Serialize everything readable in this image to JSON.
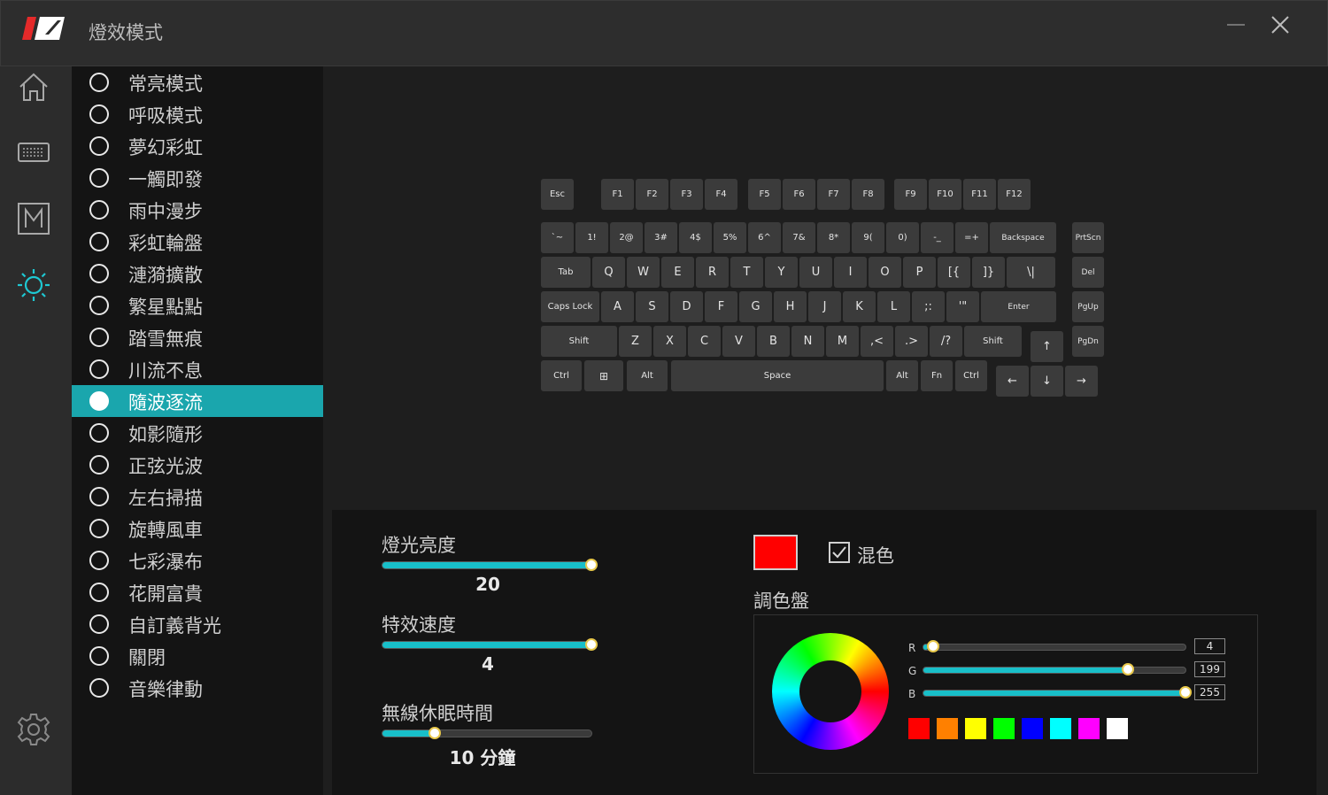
{
  "window": {
    "title": "燈效模式",
    "minimize_icon": "minimize-icon",
    "close_icon": "close-icon",
    "brand_color": "#e52a2a"
  },
  "nav": {
    "items": [
      {
        "name": "home-icon"
      },
      {
        "name": "keyboard-icon"
      },
      {
        "name": "macro-icon",
        "glyph": "M"
      },
      {
        "name": "lighting-icon",
        "active": true
      },
      {
        "name": "settings-gear-icon"
      }
    ],
    "active_color": "#1ec8d2"
  },
  "modes": {
    "items": [
      "常亮模式",
      "呼吸模式",
      "夢幻彩虹",
      "一觸即發",
      "雨中漫步",
      "彩虹輪盤",
      "漣漪擴散",
      "繁星點點",
      "踏雪無痕",
      "川流不息",
      "隨波逐流",
      "如影隨形",
      "正弦光波",
      "左右掃描",
      "旋轉風車",
      "七彩瀑布",
      "花開富貴",
      "自訂義背光",
      "關閉",
      "音樂律動"
    ],
    "selected": "隨波逐流",
    "selected_color": "#1aa6ad"
  },
  "keyboard": {
    "keys": {
      "esc": "Esc",
      "f": [
        "F1",
        "F2",
        "F3",
        "F4",
        "F5",
        "F6",
        "F7",
        "F8",
        "F9",
        "F10",
        "F11",
        "F12"
      ],
      "number_row": [
        "`~",
        "1!",
        "2@",
        "3#",
        "4$",
        "5%",
        "6^",
        "7&",
        "8*",
        "9(",
        "0)",
        "-_",
        "=+"
      ],
      "backspace": "Backspace",
      "prtscn": "PrtScn",
      "tab": "Tab",
      "qwerty_row": [
        "Q",
        "W",
        "E",
        "R",
        "T",
        "Y",
        "U",
        "I",
        "O",
        "P",
        "[{",
        "]}",
        "\\|"
      ],
      "del": "Del",
      "caps": "Caps Lock",
      "home_row": [
        "A",
        "S",
        "D",
        "F",
        "G",
        "H",
        "J",
        "K",
        "L",
        ";:",
        "'\""
      ],
      "enter": "Enter",
      "pgup": "PgUp",
      "lshift": "Shift",
      "bottom_letter_row": [
        "Z",
        "X",
        "C",
        "V",
        "B",
        "N",
        "M",
        ",<",
        ".>",
        "/?"
      ],
      "rshift": "Shift",
      "up": "↑",
      "pgdn": "PgDn",
      "ctrl": "Ctrl",
      "win": "⊞",
      "alt": "Alt",
      "space": "Space",
      "ralt": "Alt",
      "fn": "Fn",
      "rctrl": "Ctrl",
      "left": "←",
      "down": "↓",
      "right": "→"
    }
  },
  "settings": {
    "brightness": {
      "label": "燈光亮度",
      "value": "20",
      "fraction": 1.0
    },
    "speed": {
      "label": "特效速度",
      "value": "4",
      "fraction": 1.0
    },
    "sleep": {
      "label": "無線休眠時間",
      "value": "10 分鐘",
      "fraction": 0.25
    },
    "accent": "#18bfc9"
  },
  "color": {
    "current": "#ff0000",
    "mix_label": "混色",
    "mix_checked": true,
    "palette_title": "調色盤",
    "rgb": [
      {
        "label": "R",
        "value": "4",
        "fraction": 0.016
      },
      {
        "label": "G",
        "value": "199",
        "fraction": 0.78
      },
      {
        "label": "B",
        "value": "255",
        "fraction": 1.0
      }
    ],
    "swatches": [
      "#ff0000",
      "#ff8000",
      "#ffff00",
      "#00ff00",
      "#0000ff",
      "#00ffff",
      "#ff00ff",
      "#ffffff"
    ]
  }
}
